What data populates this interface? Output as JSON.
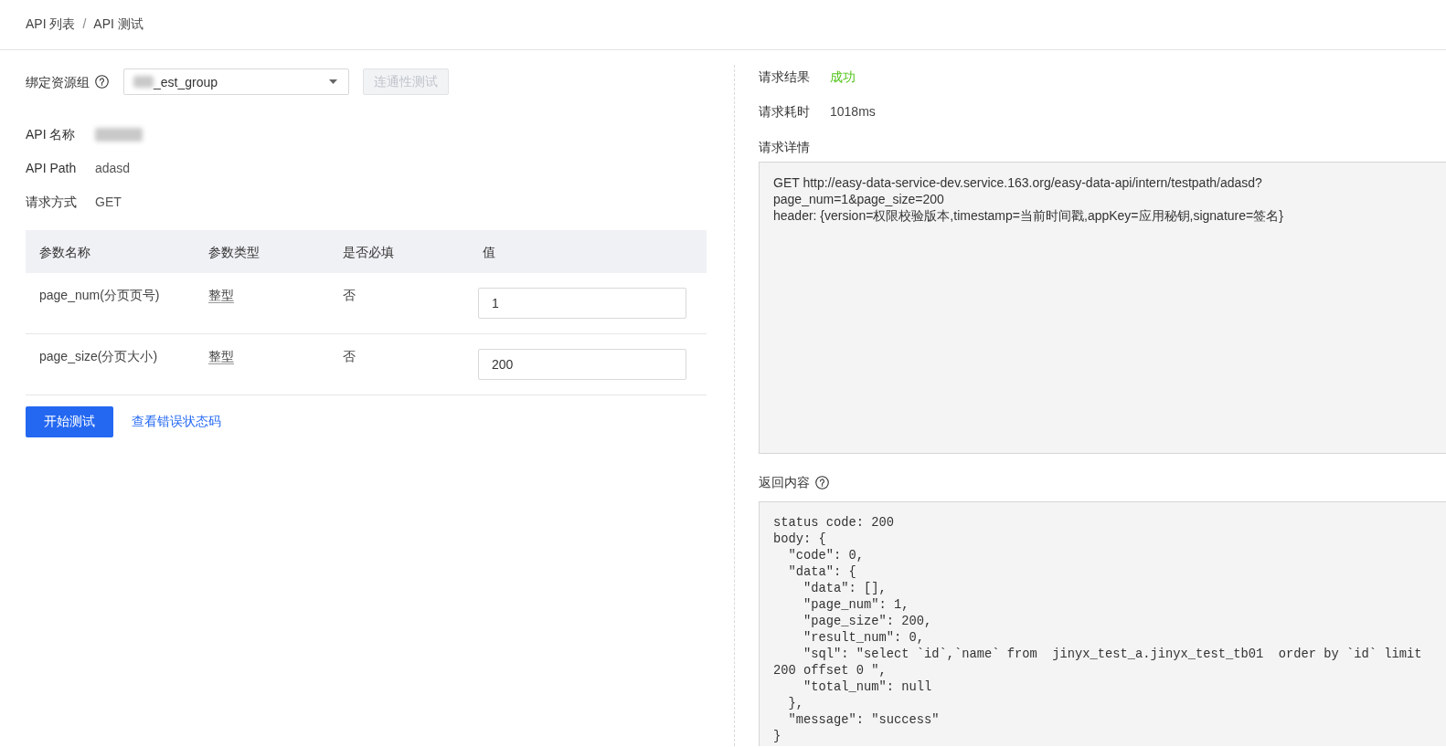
{
  "breadcrumb": {
    "items": [
      {
        "label": "API 列表"
      },
      {
        "label": "API 测试"
      }
    ],
    "separator": "/"
  },
  "form": {
    "resource_group": {
      "label": "绑定资源组",
      "value": "_est_group",
      "blurred": true
    },
    "connect_button": {
      "label": "连通性测试",
      "disabled": true
    },
    "fields": [
      {
        "label": "API 名称",
        "blurred": true
      },
      {
        "label": "API Path",
        "value": "adasd",
        "blurred": false
      },
      {
        "label": "请求方式",
        "value": "GET",
        "blurred": false
      }
    ]
  },
  "params_table": {
    "columns": [
      "参数名称",
      "参数类型",
      "是否必填",
      "值"
    ],
    "rows": [
      {
        "name": "page_num(分页页号)",
        "type": "整型",
        "required": "否",
        "value": "1"
      },
      {
        "name": "page_size(分页大小)",
        "type": "整型",
        "required": "否",
        "value": "200"
      }
    ]
  },
  "actions": {
    "start_button": "开始测试",
    "error_codes_link": "查看错误状态码"
  },
  "result": {
    "rows": [
      {
        "label": "请求结果",
        "value": "成功",
        "kind": "success"
      },
      {
        "label": "请求耗时",
        "value": "1018ms",
        "kind": "plain"
      }
    ],
    "details": {
      "label": "请求详情",
      "lines": [
        "GET http://easy-data-service-dev.service.163.org/easy-data-api/intern/testpath/adasd?",
        "page_num=1&page_size=200",
        "header: {version=权限校验版本,timestamp=当前时间戳,appKey=应用秘钥,signature=签名}"
      ]
    },
    "response": {
      "label": "返回内容",
      "lines": [
        "status code: 200",
        "body: {",
        "  \"code\": 0,",
        "  \"data\": {",
        "    \"data\": [],",
        "    \"page_num\": 1,",
        "    \"page_size\": 200,",
        "    \"result_num\": 0,",
        "    \"sql\": \"select `id`,`name` from  jinyx_test_a.jinyx_test_tb01  order by `id` limit",
        "200 offset 0 \",",
        "    \"total_num\": null",
        "  },",
        "  \"message\": \"success\"",
        "}"
      ]
    }
  }
}
